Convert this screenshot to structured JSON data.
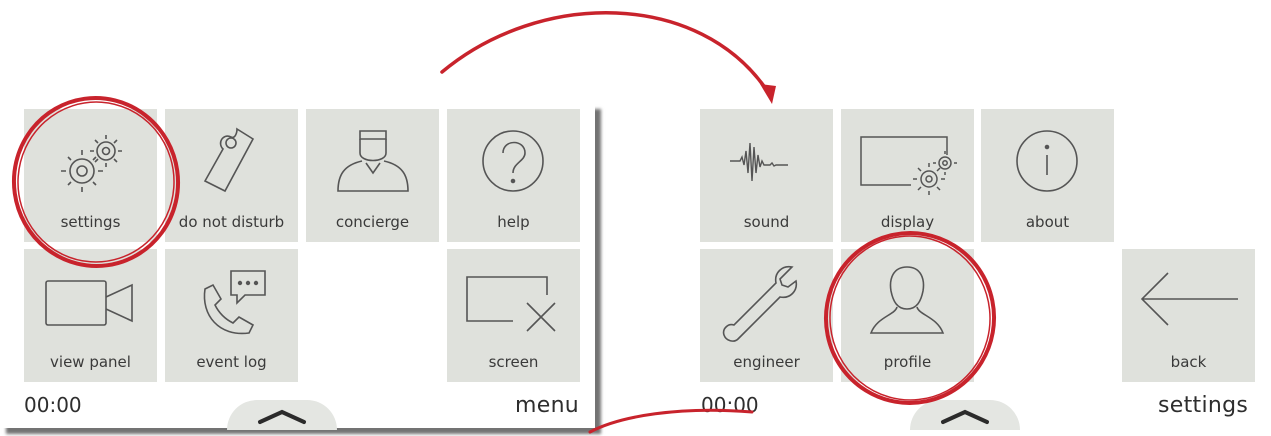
{
  "menu_screen": {
    "time": "00:00",
    "title": "menu",
    "tiles": [
      {
        "label": "settings",
        "icon": "gears-icon"
      },
      {
        "label": "do not disturb",
        "icon": "door-hanger-icon"
      },
      {
        "label": "concierge",
        "icon": "concierge-icon"
      },
      {
        "label": "help",
        "icon": "question-icon"
      },
      {
        "label": "view panel",
        "icon": "video-camera-icon"
      },
      {
        "label": "event log",
        "icon": "phone-message-icon"
      },
      {
        "label": "screen",
        "icon": "screen-off-icon"
      }
    ]
  },
  "settings_screen": {
    "time": "00:00",
    "title": "settings",
    "tiles": [
      {
        "label": "sound",
        "icon": "waveform-icon"
      },
      {
        "label": "display",
        "icon": "display-gears-icon"
      },
      {
        "label": "about",
        "icon": "info-icon"
      },
      {
        "label": "engineer",
        "icon": "wrench-icon"
      },
      {
        "label": "profile",
        "icon": "person-icon"
      },
      {
        "label": "back",
        "icon": "back-arrow-icon"
      }
    ]
  },
  "colors": {
    "tile_bg": "#dfe1dc",
    "icon_stroke": "#4a4a4a",
    "highlight": "#c8232c"
  }
}
